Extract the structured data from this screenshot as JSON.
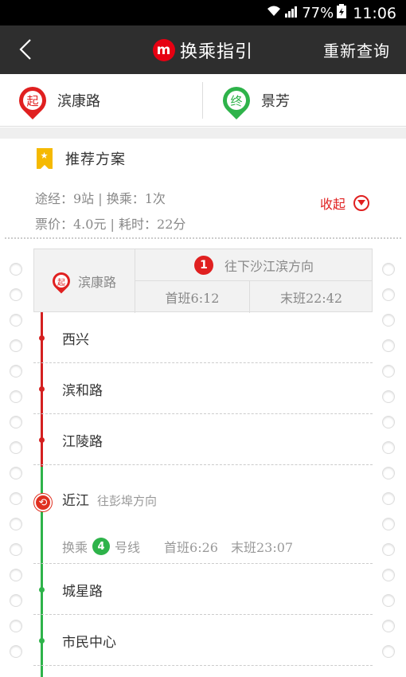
{
  "status_bar": {
    "battery": "77%",
    "time": "11:06"
  },
  "header": {
    "back_glyph": "<",
    "logo_text": "m",
    "title": "换乘指引",
    "requery_label": "重新查询"
  },
  "endpoints": {
    "start_badge": "起",
    "start_name": "滨康路",
    "end_badge": "终",
    "end_name": "景芳"
  },
  "plan": {
    "title": "推荐方案",
    "summary_line1": "途经：9站 | 换乘：1次",
    "summary_line2": "票价：4.0元 | 耗时：22分",
    "collapse_label": "收起"
  },
  "start_station": {
    "badge": "起",
    "name": "滨康路",
    "line_number": "1",
    "direction": "往下沙江滨方向",
    "first_train": "首班6:12",
    "last_train": "末班22:42"
  },
  "stations_line1": [
    "西兴",
    "滨和路",
    "江陵路"
  ],
  "transfer": {
    "station": "近江",
    "direction": "往彭埠方向",
    "prefix": "换乘",
    "line_number": "4",
    "suffix": "号线",
    "first_train": "首班6:26",
    "last_train": "末班23:07"
  },
  "stations_line4": [
    "城星路",
    "市民中心"
  ],
  "colors": {
    "line1": "#d42020",
    "line4": "#2eb34a",
    "bookmark": "#f5b900"
  }
}
